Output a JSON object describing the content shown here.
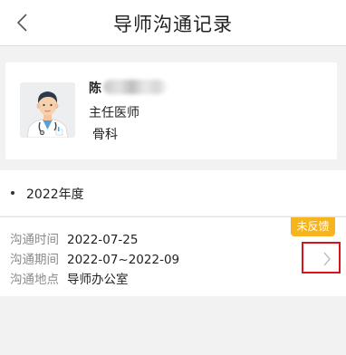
{
  "header": {
    "title": "导师沟通记录"
  },
  "doctor": {
    "name": "陈",
    "title": "主任医师",
    "department": "骨科"
  },
  "year_section": {
    "label": "2022年度"
  },
  "records": [
    {
      "status_badge": "未反馈",
      "time_label": "沟通时间",
      "time_value": "2022-07-25",
      "period_label": "沟通期间",
      "period_value": "2022-07~2022-09",
      "location_label": "沟通地点",
      "location_value": "导师办公室"
    }
  ],
  "colors": {
    "badge": "#f6b51e",
    "highlight_box": "#d9131c",
    "background": "#f2f2f2"
  },
  "icons": {
    "back": "chevron-left-icon",
    "avatar": "doctor-avatar",
    "detail": "chevron-right-icon"
  }
}
